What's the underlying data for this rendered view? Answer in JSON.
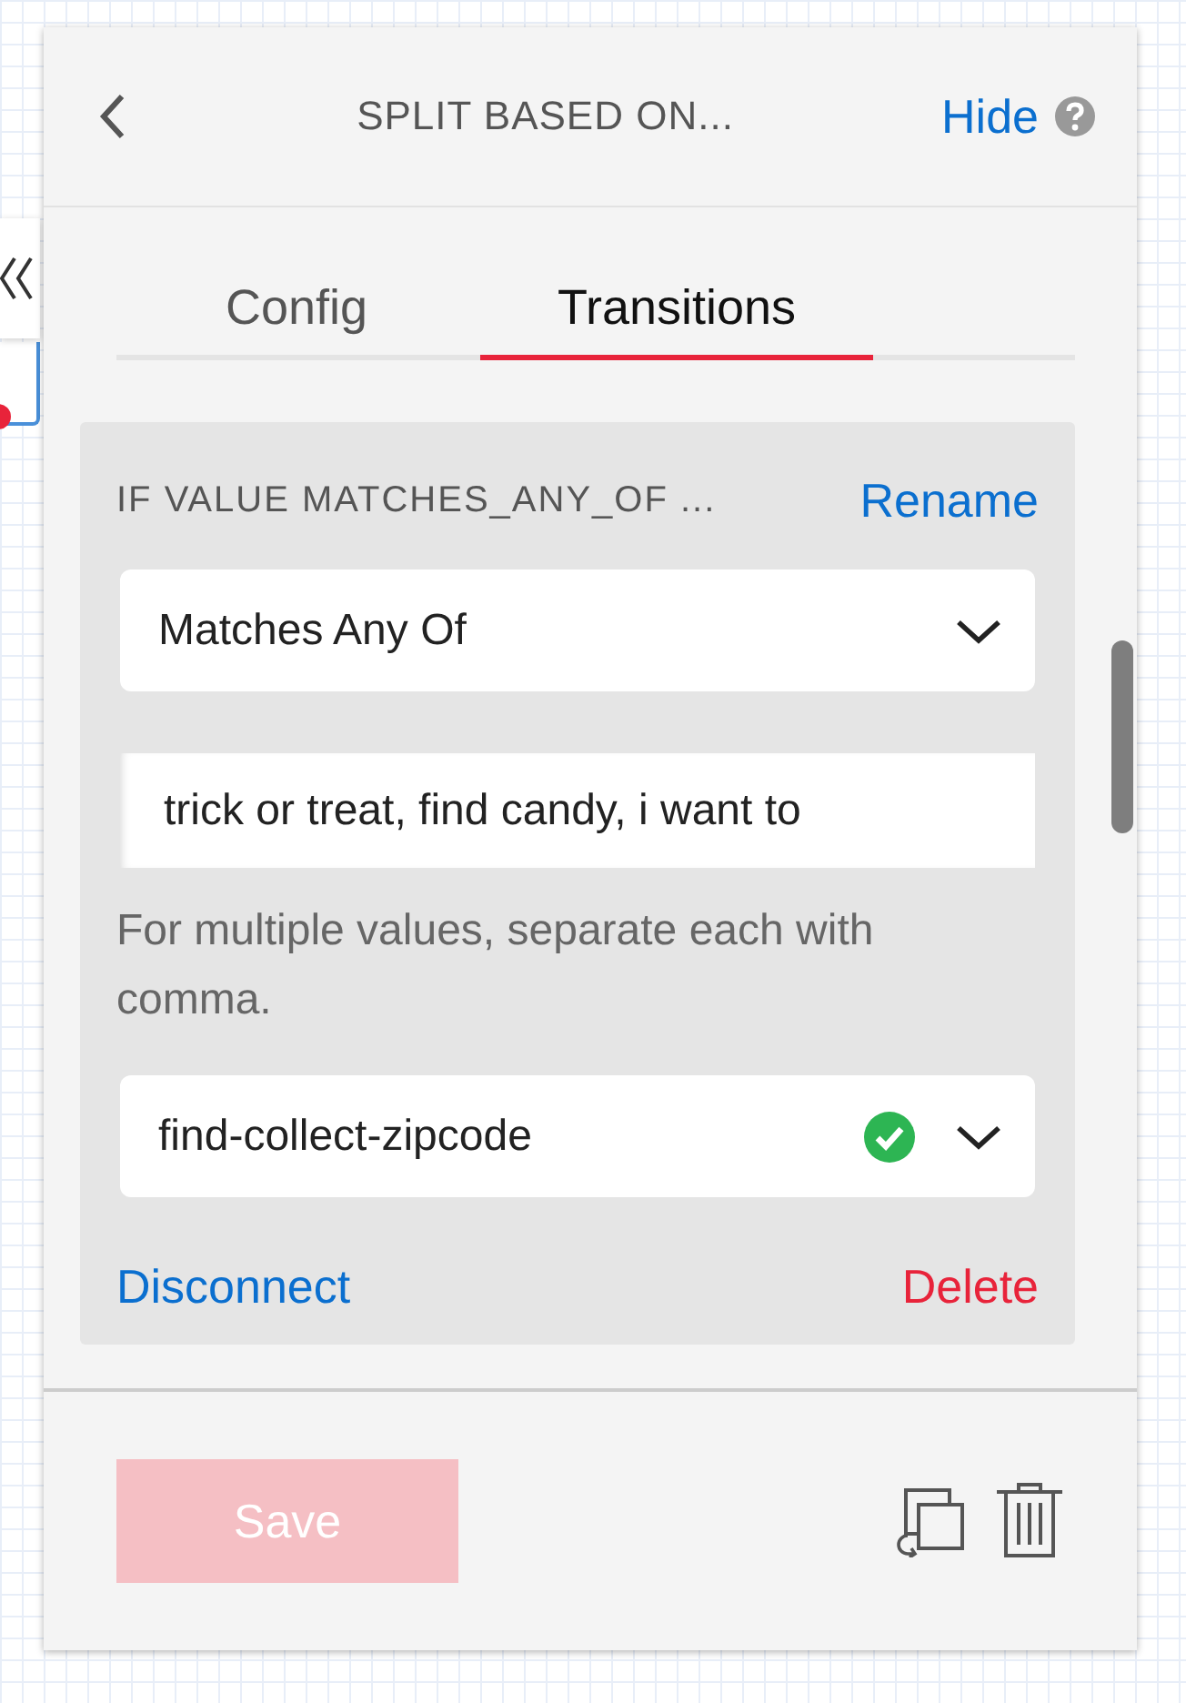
{
  "panel": {
    "title": "SPLIT BASED ON...",
    "hide_link": "Hide"
  },
  "tabs": [
    {
      "label": "Config",
      "selected": false
    },
    {
      "label": "Transitions",
      "selected": true
    }
  ],
  "transition": {
    "title": "IF VALUE MATCHES_ANY_OF ...",
    "rename": "Rename",
    "operator": "Matches Any Of",
    "values": "trick or treat, find candy, i want to",
    "hint": "For multiple values, separate each with comma.",
    "target": "find-collect-zipcode",
    "target_valid": true,
    "disconnect": "Disconnect",
    "delete": "Delete"
  },
  "footer": {
    "save": {
      "label": "Save",
      "disabled": true
    }
  }
}
